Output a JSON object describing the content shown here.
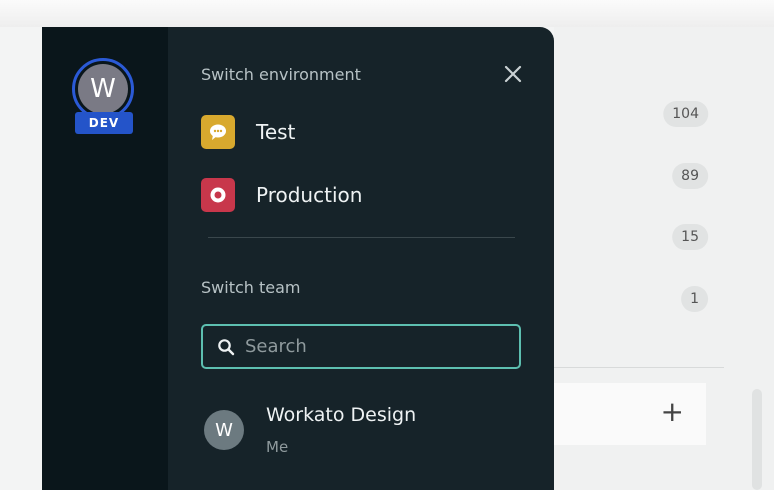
{
  "background": {
    "counts": [
      "104",
      "89",
      "15",
      "1"
    ],
    "add_symbol": "+"
  },
  "user": {
    "avatar_initial": "W",
    "environment_badge": "DEV"
  },
  "switch_environment": {
    "title": "Switch environment",
    "environments": [
      {
        "label": "Test",
        "icon": "chat-bubble-icon",
        "color": "#d8a92e"
      },
      {
        "label": "Production",
        "icon": "record-icon",
        "color": "#c8374b"
      }
    ]
  },
  "switch_team": {
    "title": "Switch team",
    "search_placeholder": "Search",
    "teams": [
      {
        "initial": "W",
        "name": "Workato Design",
        "role": "Me"
      }
    ]
  },
  "colors": {
    "panel": "#162329",
    "rail": "#0a161b",
    "accent_focus": "#5dbfb0",
    "badge_blue": "#2454c9"
  }
}
